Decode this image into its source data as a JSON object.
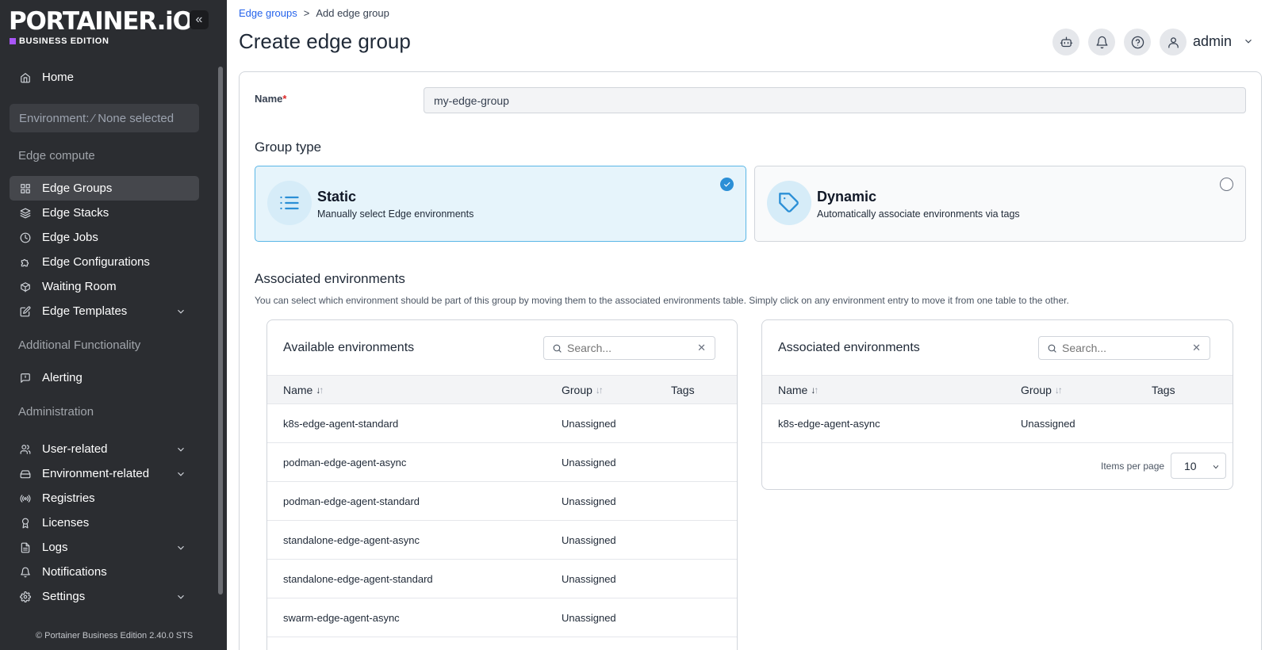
{
  "sidebar": {
    "logo": "PORTAINER.iO",
    "edition": "BUSINESS EDITION",
    "collapse_label": "«",
    "home": "Home",
    "environment_label": "Environment: ⁄ None selected",
    "section_edge": "Edge compute",
    "edge_items": [
      {
        "label": "Edge Groups",
        "icon": "grid-icon"
      },
      {
        "label": "Edge Stacks",
        "icon": "layers-icon"
      },
      {
        "label": "Edge Jobs",
        "icon": "clock-icon"
      },
      {
        "label": "Edge Configurations",
        "icon": "puzzle-icon"
      },
      {
        "label": "Waiting Room",
        "icon": "box-icon"
      },
      {
        "label": "Edge Templates",
        "icon": "edit-icon"
      }
    ],
    "section_additional": "Additional Functionality",
    "alerting": "Alerting",
    "section_admin": "Administration",
    "admin_items": [
      {
        "label": "User-related",
        "icon": "users-icon"
      },
      {
        "label": "Environment-related",
        "icon": "hdd-icon"
      },
      {
        "label": "Registries",
        "icon": "radio-icon"
      },
      {
        "label": "Licenses",
        "icon": "award-icon"
      },
      {
        "label": "Logs",
        "icon": "file-icon"
      },
      {
        "label": "Notifications",
        "icon": "bell-icon"
      },
      {
        "label": "Settings",
        "icon": "gear-icon"
      }
    ],
    "footer": "© Portainer Business Edition  2.40.0 STS"
  },
  "header": {
    "breadcrumb_parent": "Edge groups",
    "breadcrumb_sep": ">",
    "breadcrumb_current": "Add edge group",
    "title": "Create edge group",
    "user": "admin"
  },
  "form": {
    "name_label": "Name",
    "required_mark": "*",
    "name_value": "my-edge-group",
    "group_type_label": "Group type",
    "static_title": "Static",
    "static_desc": "Manually select Edge environments",
    "dynamic_title": "Dynamic",
    "dynamic_desc": "Automatically associate environments via tags",
    "selected_type": "static",
    "assoc_title": "Associated environments",
    "assoc_help": "You can select which environment should be part of this group by moving them to the associated environments table. Simply click on any environment entry to move it from one table to the other."
  },
  "available": {
    "title": "Available environments",
    "search_placeholder": "Search...",
    "col_name": "Name",
    "col_group": "Group",
    "col_tags": "Tags",
    "rows": [
      {
        "name": "k8s-edge-agent-standard",
        "group": "Unassigned",
        "tags": ""
      },
      {
        "name": "podman-edge-agent-async",
        "group": "Unassigned",
        "tags": ""
      },
      {
        "name": "podman-edge-agent-standard",
        "group": "Unassigned",
        "tags": ""
      },
      {
        "name": "standalone-edge-agent-async",
        "group": "Unassigned",
        "tags": ""
      },
      {
        "name": "standalone-edge-agent-standard",
        "group": "Unassigned",
        "tags": ""
      },
      {
        "name": "swarm-edge-agent-async",
        "group": "Unassigned",
        "tags": ""
      }
    ]
  },
  "associated": {
    "title": "Associated environments",
    "search_placeholder": "Search...",
    "col_name": "Name",
    "col_group": "Group",
    "col_tags": "Tags",
    "rows": [
      {
        "name": "k8s-edge-agent-async",
        "group": "Unassigned",
        "tags": ""
      }
    ],
    "items_per_page_label": "Items per page",
    "items_per_page_value": "10"
  },
  "colors": {
    "sidebar_bg": "#2b2d31",
    "accent": "#2b8fd6",
    "edition_mark": "#a855f7",
    "required": "#dc2626",
    "link": "#2563eb"
  }
}
